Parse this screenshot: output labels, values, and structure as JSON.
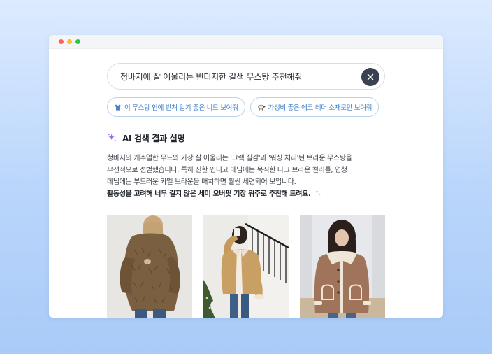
{
  "colors": {
    "accent": "#3d7fc7",
    "dot_red": "#ff5f57",
    "dot_yellow": "#febc2e",
    "dot_green": "#28c840"
  },
  "search": {
    "query": "청바지에 잘 어울리는 빈티지한 갈색 무스탕 추천해줘",
    "clear_icon": "close-icon"
  },
  "suggestions": [
    {
      "icon": "shirt-icon",
      "label": "이 무스탕 안에 받쳐 입기 좋은 니트 보여줘"
    },
    {
      "icon": "sheep-icon",
      "label": "가성비 좋은 에코 레더 소재로만 보여줘"
    }
  ],
  "ai_summary": {
    "icon": "sparkle-icon",
    "title": "AI 검색 결과 설명",
    "lines": [
      "청바지의 캐주얼한 무드와 가장 잘 어울리는 '크랙 질감'과 '워싱 처리'된 브라운 무스탕을",
      "우선적으로 선별했습니다. 특히 진한 인디고 데님에는 묵직한 다크 브라운 컬러를, 연청",
      "데님에는 부드러운 카멜 브라운을 매치하면 훨씬 세련되어 보입니다."
    ],
    "bold_line": "활동성을 고려해 너무 길지 않은 세미 오버핏 기장 위주로 추천해 드려요."
  },
  "products": [
    {
      "image": "shaggy-brown-coat-photo"
    },
    {
      "image": "camel-shearling-jacket-photo"
    },
    {
      "image": "brown-mustang-coat-photo"
    }
  ]
}
